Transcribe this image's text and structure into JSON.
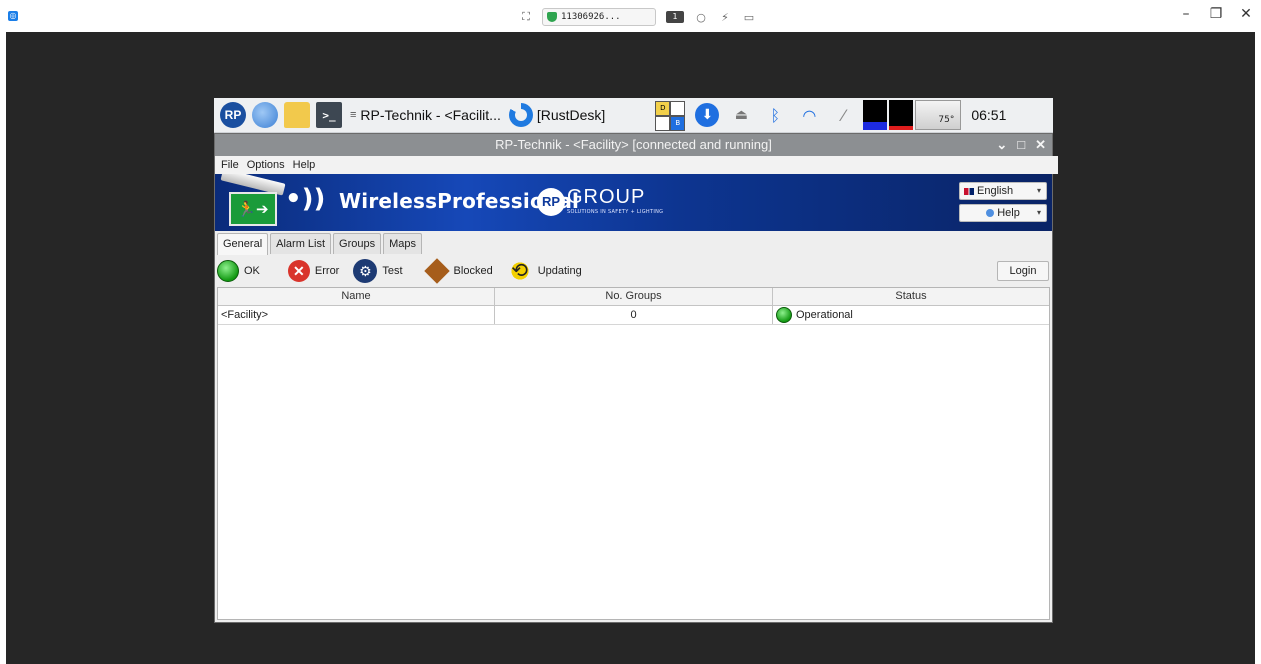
{
  "outer_window": {
    "session_id": "11306926...",
    "monitor_number": "1"
  },
  "taskbar": {
    "tasks": [
      {
        "label": "RP-Technik - <Facilit..."
      },
      {
        "label": "[RustDesk]"
      }
    ],
    "keyboard_layout": {
      "top": "D",
      "bottom": "B"
    },
    "temperature": "75°",
    "clock": "06:51"
  },
  "app": {
    "title": "RP-Technik - <Facility> [connected and running]",
    "menu": [
      "File",
      "Options",
      "Help"
    ],
    "banner": {
      "product_name": "WirelessProfessional",
      "group_name": "GROUP",
      "logo_text": "RP",
      "slogan": "SOLUTIONS IN SAFETY + LIGHTING"
    },
    "language_select": {
      "value": "English"
    },
    "help_select": {
      "value": "Help"
    },
    "tabs": [
      "General",
      "Alarm List",
      "Groups",
      "Maps"
    ],
    "active_tab": "General",
    "legend": [
      {
        "label": "OK",
        "icon": "ok-led-icon",
        "color": "#139a13"
      },
      {
        "label": "Error",
        "icon": "error-icon",
        "color": "#d9342b"
      },
      {
        "label": "Test",
        "icon": "gear-icon",
        "color": "#1d3a73"
      },
      {
        "label": "Blocked",
        "icon": "blocked-diamond-icon",
        "color": "#a65d1b"
      },
      {
        "label": "Updating",
        "icon": "updating-arrows-icon",
        "color": "#f3d000"
      }
    ],
    "login_label": "Login",
    "grid": {
      "columns": [
        "Name",
        "No. Groups",
        "Status"
      ],
      "rows": [
        {
          "name": "<Facility>",
          "groups": "0",
          "status": "Operational"
        }
      ]
    }
  }
}
